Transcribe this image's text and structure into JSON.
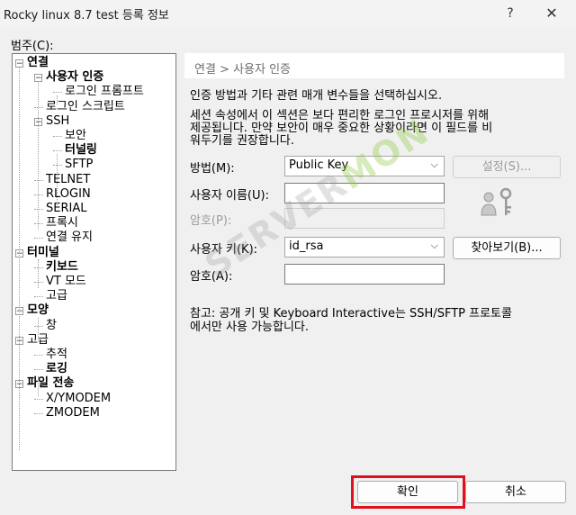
{
  "window": {
    "title": "Rocky linux 8.7 test 등록 정보",
    "help": "?",
    "close": "✕"
  },
  "category_label": "범주(C):",
  "tree": [
    {
      "label": "연결",
      "bold": true,
      "expander": "−"
    },
    {
      "label": "사용자 인증",
      "bold": true,
      "expander": "−"
    },
    {
      "label": "로그인 프롬프트",
      "bold": false
    },
    {
      "label": "로그인 스크립트",
      "bold": false
    },
    {
      "label": "SSH",
      "bold": false,
      "expander": "−"
    },
    {
      "label": "보안",
      "bold": false
    },
    {
      "label": "터널링",
      "bold": true
    },
    {
      "label": "SFTP",
      "bold": false
    },
    {
      "label": "TELNET",
      "bold": false
    },
    {
      "label": "RLOGIN",
      "bold": false
    },
    {
      "label": "SERIAL",
      "bold": false
    },
    {
      "label": "프록시",
      "bold": false
    },
    {
      "label": "연결 유지",
      "bold": false
    },
    {
      "label": "터미널",
      "bold": true,
      "expander": "−"
    },
    {
      "label": "키보드",
      "bold": true
    },
    {
      "label": "VT 모드",
      "bold": false
    },
    {
      "label": "고급",
      "bold": false
    },
    {
      "label": "모양",
      "bold": true,
      "expander": "−"
    },
    {
      "label": "창",
      "bold": false
    },
    {
      "label": "고급",
      "bold": false,
      "expander": "−"
    },
    {
      "label": "추적",
      "bold": false
    },
    {
      "label": "로깅",
      "bold": true
    },
    {
      "label": "파일 전송",
      "bold": true,
      "expander": "−"
    },
    {
      "label": "X/YMODEM",
      "bold": false
    },
    {
      "label": "ZMODEM",
      "bold": false
    }
  ],
  "panel": {
    "breadcrumb": "연결 > 사용자 인증",
    "description": "인증 방법과 기타 관련 매개 변수들을 선택하십시오.",
    "note_line1": "세션 속성에서 이 섹션은 보다 편리한 로그인 프로시저를 위해",
    "note_line2": "제공됩니다. 만약 보안이 매우 중요한 상황이라면 이 필드를 비",
    "note_line3": "워두기를 권장합니다.",
    "method_label": "방법(M):",
    "method_value": "Public Key",
    "settings_button": "설정(S)...",
    "username_label": "사용자 이름(U):",
    "username_value": "",
    "password_label": "암호(P):",
    "password_value": "",
    "user_key_label": "사용자 키(K):",
    "user_key_value": "id_rsa",
    "browse_button": "찾아보기(B)...",
    "passphrase_label": "암호(A):",
    "passphrase_value": "",
    "footnote_line1": "참고: 공개 키 및 Keyboard Interactive는 SSH/SFTP 프로토콜",
    "footnote_line2": "에서만 사용 가능합니다.",
    "key_icon": "user-key-icon"
  },
  "buttons": {
    "ok": "확인",
    "cancel": "취소"
  },
  "watermark": {
    "part1": "SERVER",
    "part2": "MON"
  },
  "colors": {
    "highlight": "#e0101f",
    "panel_header": "#ffffff"
  }
}
